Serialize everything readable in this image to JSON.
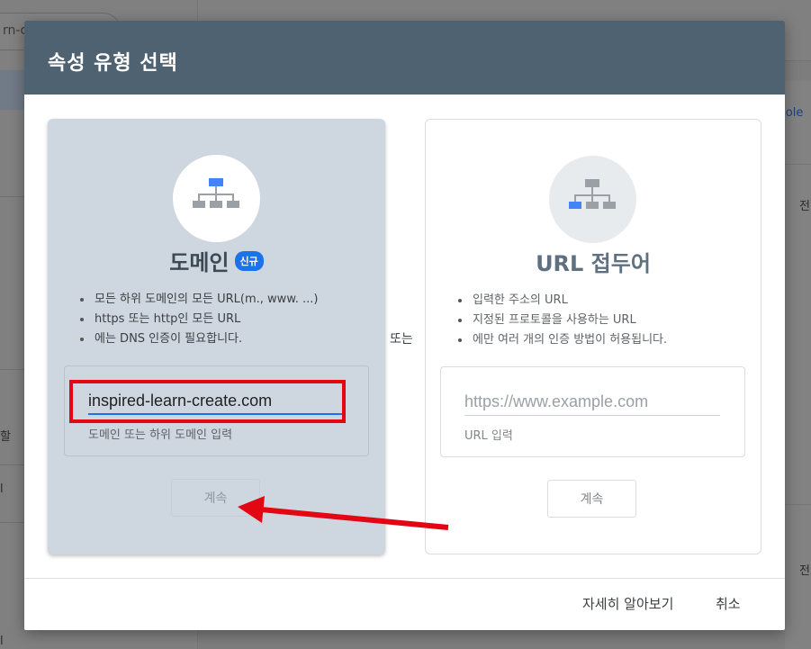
{
  "background": {
    "search_text": "rn-c",
    "right_link": "sole",
    "right_text_1": "전",
    "right_text_2": "전",
    "sidebar_text_1": "할",
    "sidebar_text_2": "l"
  },
  "dialog": {
    "title": "속성 유형 선택",
    "or_label": "또는",
    "footer": {
      "learn_more": "자세히 알아보기",
      "cancel": "취소"
    }
  },
  "domain_card": {
    "title": "도메인",
    "badge": "신규",
    "bullets": [
      "모든 하위 도메인의 모든 URL(m., www. ...)",
      "https 또는 http인 모든 URL",
      "에는 DNS 인증이 필요합니다."
    ],
    "input_value": "inspired-learn-create.com",
    "input_hint": "도메인 또는 하위 도메인 입력",
    "continue_label": "계속"
  },
  "url_card": {
    "title": "URL 접두어",
    "bullets": [
      "입력한 주소의 URL",
      "지정된 프로토콜을 사용하는 URL",
      "에만 여러 개의 인증 방법이 허용됩니다."
    ],
    "input_placeholder": "https://www.example.com",
    "input_hint": "URL 입력",
    "continue_label": "계속"
  },
  "colors": {
    "header": "#4f6271",
    "domain_card_bg": "#ced7df",
    "accent_blue": "#1a73e8",
    "annotation_red": "#e30613"
  }
}
